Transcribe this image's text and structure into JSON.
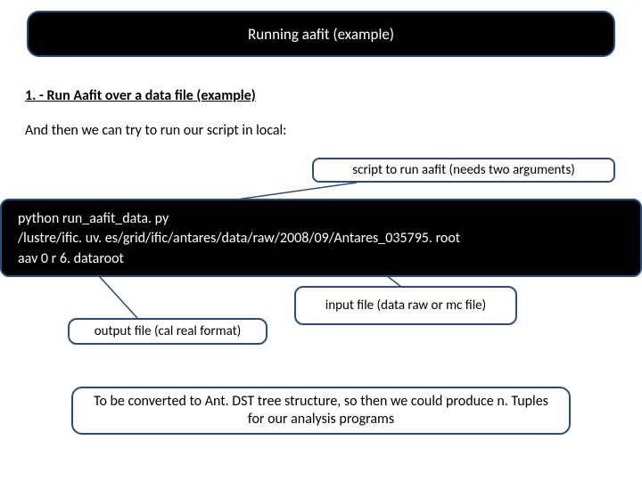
{
  "title": "Running aafit (example)",
  "step_heading": "1. -  Run Aafit over a data file (example)",
  "description": "And then we can try to run our script in local:",
  "callouts": {
    "script": "script to run aafit (needs two arguments)",
    "input": "input file (data raw or mc file)",
    "output": "output file (cal real format)"
  },
  "code": {
    "line1": "python run_aafit_data. py",
    "line2": "/lustre/ific. uv. es/grid/ific/antares/data/raw/2008/09/Antares_035795. root",
    "line3": "aav 0 r 6. dataroot"
  },
  "footer": "To be converted to Ant. DST tree structure, so then we could produce n. Tuples for our analysis programs"
}
